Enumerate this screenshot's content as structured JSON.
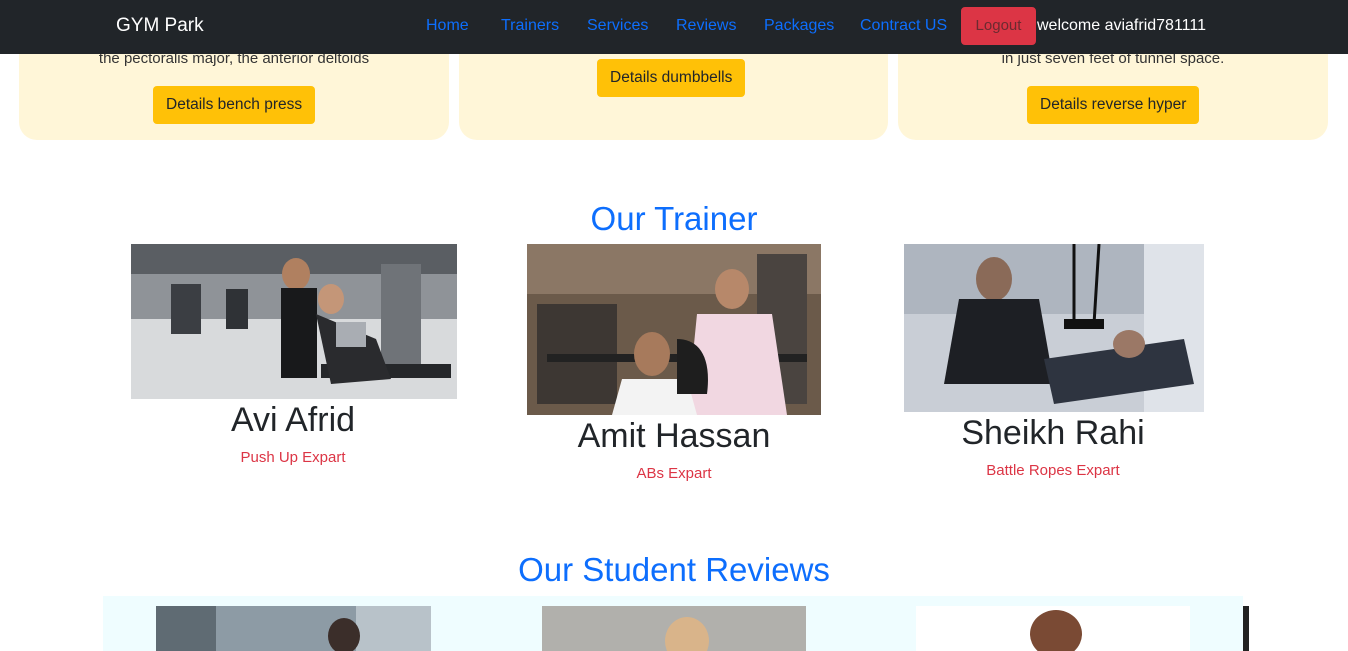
{
  "nav": {
    "brand": "GYM Park",
    "links": [
      "Home",
      "Trainers",
      "Services",
      "Reviews",
      "Packages",
      "Contract US"
    ],
    "logout": "Logout",
    "welcome": "welcome aviafrid781111"
  },
  "equipment_cards": [
    {
      "text": "the pectoralis major, the anterior deltoids",
      "button": "Details bench press"
    },
    {
      "text": "",
      "button": "Details dumbbells"
    },
    {
      "text": "in just seven feet of tunnel space.",
      "button": "Details reverse hyper"
    }
  ],
  "trainers_section": {
    "title": "Our Trainer",
    "trainers": [
      {
        "name": "Avi Afrid",
        "role": "Push Up Expart"
      },
      {
        "name": "Amit Hassan",
        "role": "ABs Expart"
      },
      {
        "name": "Sheikh Rahi",
        "role": "Battle Ropes Expart"
      }
    ]
  },
  "reviews_section": {
    "title": "Our Student Reviews"
  }
}
